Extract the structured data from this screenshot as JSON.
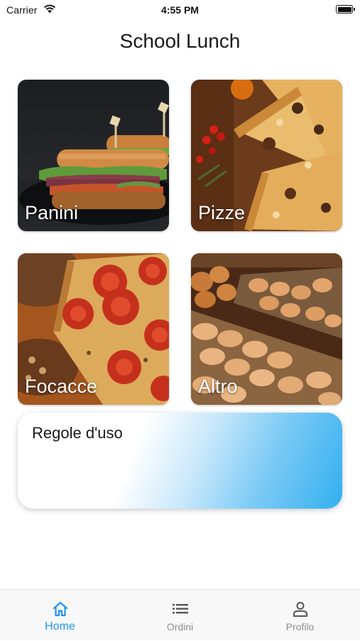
{
  "status_bar": {
    "carrier": "Carrier",
    "time": "4:55 PM",
    "icons": [
      "wifi-icon",
      "battery-icon"
    ]
  },
  "header": {
    "title": "School Lunch"
  },
  "categories": [
    {
      "label": "Panini",
      "image": "sandwich-photo"
    },
    {
      "label": "Pizze",
      "image": "pizza-photo"
    },
    {
      "label": "Focacce",
      "image": "focaccia-photo"
    },
    {
      "label": "Altro",
      "image": "pastries-photo"
    }
  ],
  "rules_card": {
    "title": "Regole d'uso"
  },
  "tab_bar": {
    "tabs": [
      {
        "label": "Home",
        "icon": "home-icon",
        "active": true
      },
      {
        "label": "Ordini",
        "icon": "list-icon",
        "active": false
      },
      {
        "label": "Profilo",
        "icon": "person-icon",
        "active": false
      }
    ],
    "active_color": "#2196f3",
    "inactive_color": "#8e8e93"
  }
}
